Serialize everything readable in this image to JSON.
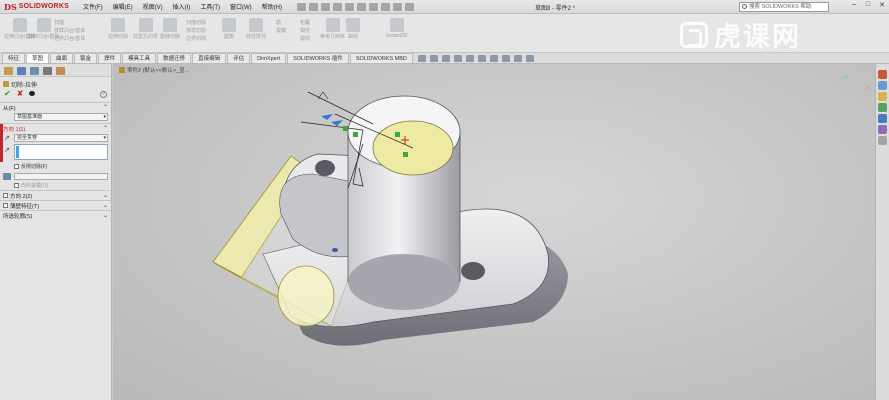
{
  "app": {
    "brand": "SOLIDWORKS",
    "brand_prefix": "DS",
    "document_title": "草图8 - 零件2 *",
    "search_placeholder": "搜索 SOLIDWORKS 帮助"
  },
  "menu": [
    "文件(F)",
    "编辑(E)",
    "视图(V)",
    "插入(I)",
    "工具(T)",
    "窗口(W)",
    "帮助(H)"
  ],
  "ribbon": {
    "groups": [
      {
        "label": "拉伸凸台/基体"
      },
      {
        "label": "旋转凸台/基体"
      },
      {
        "label": "拉伸切除"
      },
      {
        "label": "异型孔向导"
      },
      {
        "label": "旋转切除"
      },
      {
        "label": "圆角"
      },
      {
        "label": "线性阵列"
      },
      {
        "label": "筋"
      },
      {
        "label": "拔模"
      },
      {
        "label": "参考几何体"
      },
      {
        "label": "曲线"
      },
      {
        "label": "Instant3D"
      }
    ],
    "small_col1": [
      "扫描",
      "放样凸台/基体",
      "边界凸台/基体"
    ],
    "small_col2": [
      "扫描切除",
      "放样切割",
      "边界切除"
    ],
    "small_col3": [
      "包覆",
      "相交",
      "镜向"
    ]
  },
  "tabs": [
    "特征",
    "草图",
    "曲面",
    "钣金",
    "焊件",
    "模具工具",
    "数据迁移",
    "直接编辑",
    "评估",
    "DimXpert",
    "SOLIDWORKS 插件",
    "SOLIDWORKS MBD"
  ],
  "active_tab": "草图",
  "breadcrumb": "零件2 (默认<<默认>_显...",
  "property_manager": {
    "title": "切除-拉伸",
    "help": "?",
    "from_label": "从(F)",
    "from_value": "草图基准面",
    "direction1_label": "方向 1(1)",
    "end_condition": "完全贯穿",
    "reverse_cut": "反侧切除(F)",
    "draft_outward": "向外拔模(O)",
    "direction2_label": "方向 2(2)",
    "thin_feature_label": "薄壁特征(T)",
    "selected_contours_label": "所选轮廓(S)"
  },
  "watermark": "虎课网",
  "colors": {
    "accent_red": "#c1272d",
    "select_blue": "#4aa0e6",
    "sketch_yellow": "#f1eea8"
  }
}
